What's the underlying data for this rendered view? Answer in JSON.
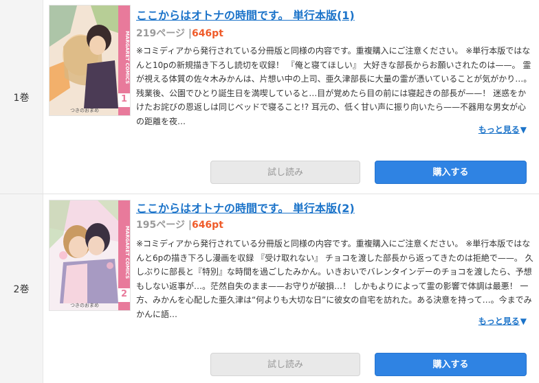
{
  "volumes": [
    {
      "volume_label": "1巻",
      "title": "ここからはオトナの時間です。 単行本版(1)",
      "pages": "219ページ",
      "separator": " |",
      "price": "646pt",
      "description": "※コミディアから発行されている分冊版と同様の内容です。重複購入にご注意ください。 ※単行本版ではなんと10pの新規描き下ろし読切を収録！ 『俺と寝てほしい』 大好きな部長からお願いされたのは——。 霊が視える体質の佐々木みかんは、片想い中の上司、亜久津部長に大量の霊が憑いていることが気がかり…。残業後、公園でひとり誕生日を満喫していると…目が覚めたら目の前には寝起きの部長が——！ 迷惑をかけたお詫びの恩返しは同じベッドで寝ること!? 耳元の、低く甘い声に振り向いたら——不器用な男女が心の距離を夜…",
      "more_label": "もっと見る",
      "more_icon": "triangle-down-icon",
      "trial_label": "試し読み",
      "buy_label": "購入する",
      "cover_number": "1",
      "cover_brand": "MARGARET COMICS",
      "cover_author": "つきのおまめ"
    },
    {
      "volume_label": "2巻",
      "title": "ここからはオトナの時間です。 単行本版(2)",
      "pages": "195ページ",
      "separator": " |",
      "price": "646pt",
      "description": "※コミディアから発行されている分冊版と同様の内容です。重複購入にご注意ください。 ※単行本版ではなんと6pの描き下ろし漫画を収録 『受け取れない』 チョコを渡した部長から返ってきたのは拒絶で——。 久しぶりに部長と『特別』な時間を過ごしたみかん。いきおいでバレンタインデーのチョコを渡したら、予想もしない返事が…。茫然自失のまま——お守りが破損…！ しかもよりによって霊の影響で体調は最悪！ 一方、みかんを心配した亜久津は“何よりも大切な日”に彼女の自宅を訪れた。ある決意を持って…。今までみかんに語…",
      "more_label": "もっと見る",
      "more_icon": "triangle-down-icon",
      "trial_label": "試し読み",
      "buy_label": "購入する",
      "cover_number": "2",
      "cover_brand": "MARGARET COMICS",
      "cover_author": "つきのおまめ"
    }
  ],
  "colors": {
    "link": "#1b73c9",
    "price": "#ef5b2a",
    "buy_button": "#2f83e3",
    "trial_button": "#e9e9e9",
    "cover_band_pink": "#e87a9b"
  }
}
